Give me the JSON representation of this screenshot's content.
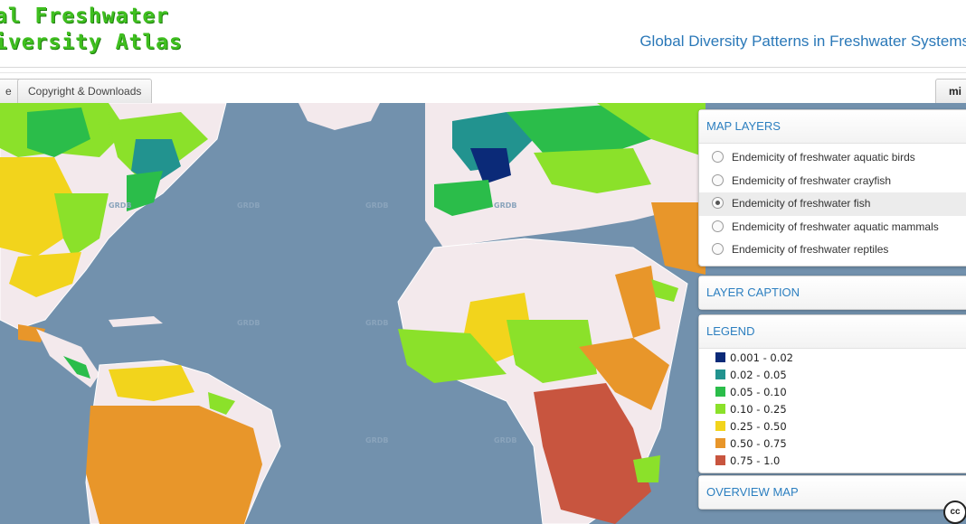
{
  "header": {
    "logo_line1": "al Freshwater",
    "logo_line2": "iversity Atlas",
    "subtitle": "Global Diversity Patterns in Freshwater Systems"
  },
  "tabs": [
    {
      "label": "e"
    },
    {
      "label": "Copyright & Downloads"
    }
  ],
  "right_tab": {
    "label": "mi"
  },
  "map": {
    "watermark": "GRDB",
    "attribution_icon": "cc"
  },
  "map_layers": {
    "title": "MAP LAYERS",
    "items": [
      {
        "label": "Endemicity of freshwater aquatic birds",
        "selected": false
      },
      {
        "label": "Endemicity of freshwater crayfish",
        "selected": false
      },
      {
        "label": "Endemicity of freshwater fish",
        "selected": true
      },
      {
        "label": "Endemicity of freshwater aquatic mammals",
        "selected": false
      },
      {
        "label": "Endemicity of freshwater reptiles",
        "selected": false
      }
    ]
  },
  "layer_caption": {
    "title": "LAYER CAPTION"
  },
  "legend": {
    "title": "LEGEND",
    "items": [
      {
        "label": "0.001 - 0.02",
        "color": "#0b2a78"
      },
      {
        "label": "0.02 - 0.05",
        "color": "#22938f"
      },
      {
        "label": "0.05 - 0.10",
        "color": "#2bbd4a"
      },
      {
        "label": "0.10 - 0.25",
        "color": "#8be12a"
      },
      {
        "label": "0.25 - 0.50",
        "color": "#f2d41c"
      },
      {
        "label": "0.50 - 0.75",
        "color": "#e8962a"
      },
      {
        "label": "0.75 - 1.0",
        "color": "#c8553f"
      }
    ]
  },
  "overview_map": {
    "title": "OVERVIEW MAP"
  }
}
